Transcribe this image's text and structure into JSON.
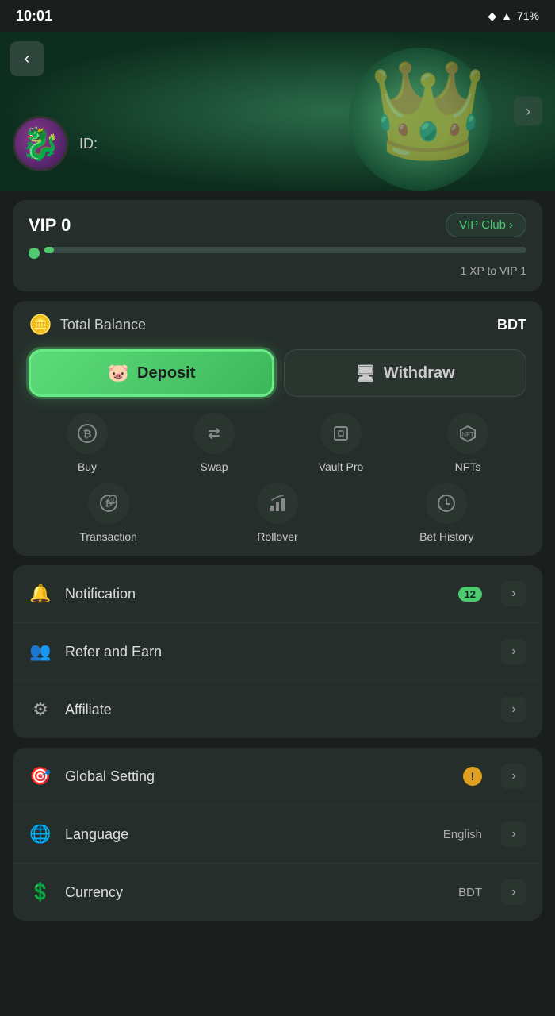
{
  "statusBar": {
    "time": "10:01",
    "battery": "71%",
    "batteryIcon": "🔋"
  },
  "header": {
    "userId": "ID:",
    "avatarEmoji": "🐉"
  },
  "vip": {
    "label": "VIP 0",
    "clubBtn": "VIP Club",
    "xpText": "1 XP to VIP 1",
    "progress": 2
  },
  "balance": {
    "totalLabel": "Total Balance",
    "currency": "BDT",
    "coinEmoji": "🪙"
  },
  "actions": {
    "depositLabel": "Deposit",
    "withdrawLabel": "Withdraw"
  },
  "quickIcons": [
    {
      "id": "buy",
      "label": "Buy",
      "emoji": "₿"
    },
    {
      "id": "swap",
      "label": "Swap",
      "emoji": "⇅"
    },
    {
      "id": "vault-pro",
      "label": "Vault Pro",
      "emoji": "▦"
    },
    {
      "id": "nfts",
      "label": "NFTs",
      "emoji": "⬡"
    },
    {
      "id": "transaction",
      "label": "Transaction",
      "emoji": "₿"
    },
    {
      "id": "rollover",
      "label": "Rollover",
      "emoji": "📊"
    },
    {
      "id": "bet-history",
      "label": "Bet History",
      "emoji": "🕐"
    }
  ],
  "menuItems": [
    {
      "id": "notification",
      "label": "Notification",
      "icon": "🔔",
      "badge": "12"
    },
    {
      "id": "refer-earn",
      "label": "Refer and Earn",
      "icon": "👥",
      "badge": ""
    },
    {
      "id": "affiliate",
      "label": "Affiliate",
      "icon": "⚙",
      "badge": ""
    }
  ],
  "settingsItems": [
    {
      "id": "global-setting",
      "label": "Global Setting",
      "icon": "🎯",
      "warning": true,
      "value": ""
    },
    {
      "id": "language",
      "label": "Language",
      "icon": "🌐",
      "warning": false,
      "value": "English"
    },
    {
      "id": "currency",
      "label": "Currency",
      "icon": "💲",
      "warning": false,
      "value": "BDT"
    }
  ]
}
